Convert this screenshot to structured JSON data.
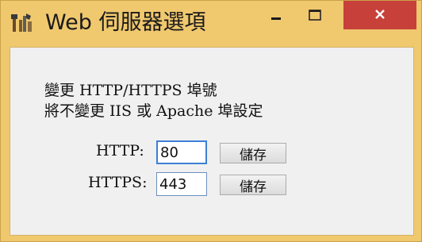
{
  "window": {
    "title": "Web 伺服器選項",
    "minimize_glyph": "–",
    "maximize_glyph": "☐",
    "close_glyph": "✕",
    "app_icon": "tools-icon"
  },
  "content": {
    "line1": "變更 HTTP/HTTPS 埠號",
    "line2": "將不變更 IIS 或 Apache 埠設定"
  },
  "http": {
    "label": "HTTP:",
    "value": "80",
    "save_label": "儲存"
  },
  "https": {
    "label": "HTTPS:",
    "value": "443",
    "save_label": "儲存"
  },
  "colors": {
    "frame": "#f0c86e",
    "close_button": "#c8403a",
    "client_bg": "#f0f0f0",
    "focus_border": "#3c7fd6"
  }
}
